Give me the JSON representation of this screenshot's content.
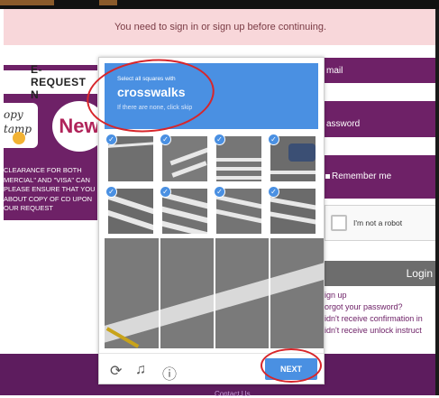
{
  "alert": {
    "message": "You need to sign in or sign up before continuing."
  },
  "banner": {
    "heading": "E-REQUEST N",
    "stamp_lines": [
      "opy",
      "tamp"
    ],
    "badge": "New",
    "lines": [
      "CLEARANCE FOR BOTH",
      "MERCIAL\" AND \"VISA\" CAN",
      "PLEASE ENSURE THAT YOU",
      "ABOUT COPY OF CD UPON",
      "OUR REQUEST"
    ]
  },
  "form": {
    "email_label": "mail",
    "password_label": "assword",
    "remember_label": "Remember me",
    "recaptcha_label": "I'm not a robot",
    "login_label": "Login",
    "links": [
      "ign up",
      "orgot your password?",
      "idn't receive confirmation in",
      "idn't receive unlock instruct"
    ]
  },
  "footer": {
    "contact": "Contact Us"
  },
  "captcha": {
    "instruction_small": "Select all squares with",
    "instruction_target": "crosswalks",
    "instruction_hint": "If there are none, click skip",
    "next_label": "NEXT",
    "icons": [
      "reload-icon",
      "headphones-icon",
      "info-icon"
    ],
    "tiles_selected": [
      true,
      true,
      true,
      true,
      true,
      true,
      true,
      true
    ]
  },
  "colors": {
    "brand": "#6e2167",
    "captcha_blue": "#4a90e2",
    "alert_bg": "#f8d7da",
    "annotation": "#d7262b"
  }
}
